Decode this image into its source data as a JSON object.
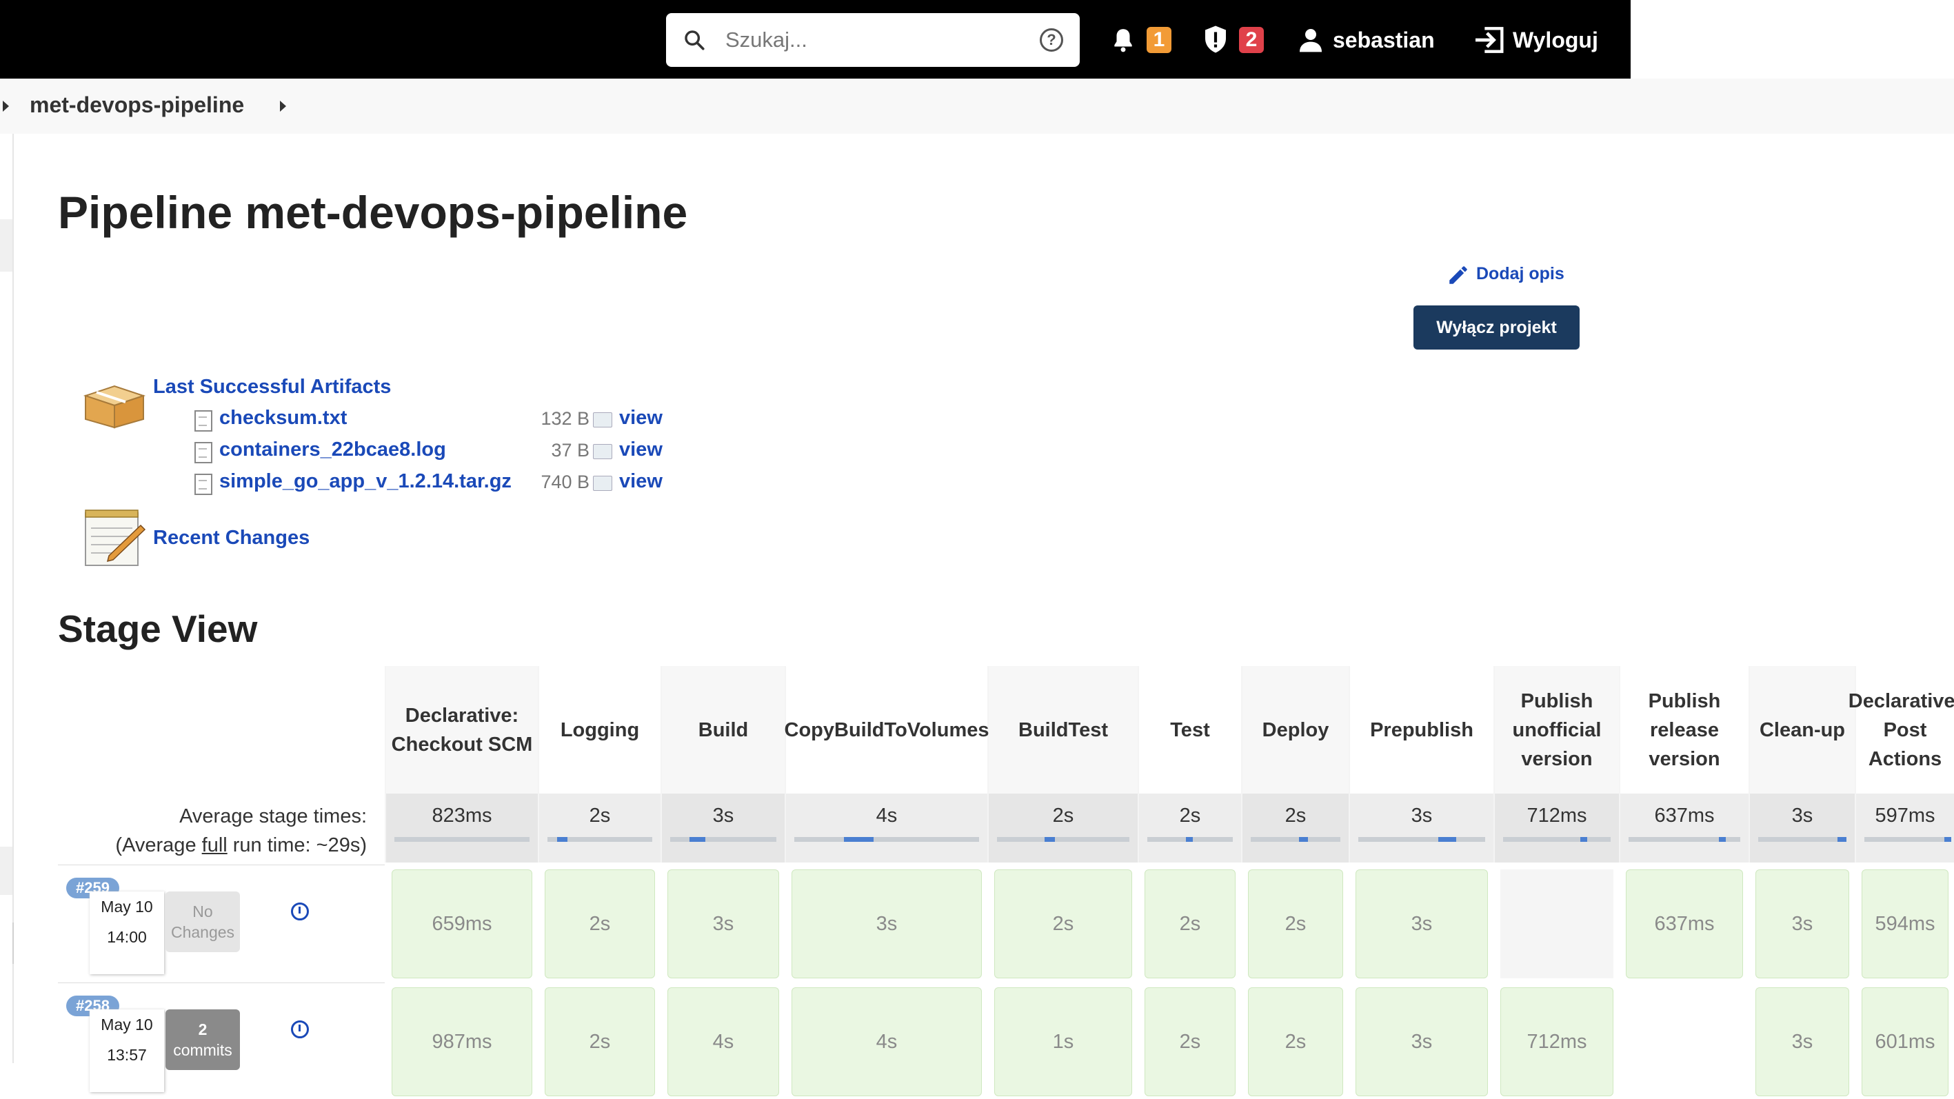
{
  "topbar": {
    "search_placeholder": "Szukaj...",
    "help_glyph": "?",
    "notifications_count": "1",
    "security_count": "2",
    "user": "sebastian",
    "logout": "Wyloguj",
    "colors": {
      "notification_badge": "#f29b36",
      "security_badge": "#e0414a",
      "bar": "#000000"
    }
  },
  "breadcrumb": {
    "project": "met-devops-pipeline"
  },
  "main": {
    "title": "Pipeline met-devops-pipeline",
    "add_description": "Dodaj opis",
    "disable_button": "Wyłącz projekt",
    "artifacts": {
      "title": "Last Successful Artifacts",
      "files": [
        {
          "name": "checksum.txt",
          "size": "132 B",
          "view": "view"
        },
        {
          "name": "containers_22bcae8.log",
          "size": "37 B",
          "view": "view"
        },
        {
          "name": "simple_go_app_v_1.2.14.tar.gz",
          "size": "740 B",
          "view": "view"
        }
      ]
    },
    "recent_changes": "Recent Changes"
  },
  "stage_view": {
    "title": "Stage View",
    "avg_label_line1": "Average stage times:",
    "avg_label_line2_prefix": "(Average ",
    "avg_label_line2_link": "full",
    "avg_label_line2_suffix": " run time: ~29s)",
    "stages": [
      {
        "name": "Declarative: Checkout SCM",
        "avg": "823ms",
        "bar_fraction": 0.0
      },
      {
        "name": "Logging",
        "avg": "2s",
        "bar_fraction": 0.1
      },
      {
        "name": "Build",
        "avg": "3s",
        "bar_fraction": 0.15
      },
      {
        "name": "CopyBuildToVolumes",
        "avg": "4s",
        "bar_fraction": 0.16
      },
      {
        "name": "BuildTest",
        "avg": "2s",
        "bar_fraction": 0.08
      },
      {
        "name": "Test",
        "avg": "2s",
        "bar_fraction": 0.08
      },
      {
        "name": "Deploy",
        "avg": "2s",
        "bar_fraction": 0.1
      },
      {
        "name": "Prepublish",
        "avg": "3s",
        "bar_fraction": 0.14
      },
      {
        "name": "Publish unofficial version",
        "avg": "712ms",
        "bar_fraction": 0.03
      },
      {
        "name": "Publish release version",
        "avg": "637ms",
        "bar_fraction": 0.03
      },
      {
        "name": "Clean-up",
        "avg": "3s",
        "bar_fraction": 0.1
      },
      {
        "name": "Declarative: Post Actions",
        "avg": "597ms",
        "bar_fraction": 0.02
      }
    ],
    "runs": [
      {
        "number": "#259",
        "date": "May 10",
        "time": "14:00",
        "changes_line1": "No",
        "changes_line2": "Changes",
        "changes_type": "none",
        "durations": [
          "659ms",
          "2s",
          "3s",
          "3s",
          "2s",
          "2s",
          "2s",
          "3s",
          "",
          "637ms",
          "3s",
          "594ms"
        ]
      },
      {
        "number": "#258",
        "date": "May 10",
        "time": "13:57",
        "changes_line1": "2",
        "changes_line2": "commits",
        "changes_type": "commits",
        "durations": [
          "987ms",
          "2s",
          "4s",
          "4s",
          "1s",
          "2s",
          "2s",
          "3s",
          "712ms",
          "",
          "3s",
          "601ms"
        ]
      }
    ]
  }
}
